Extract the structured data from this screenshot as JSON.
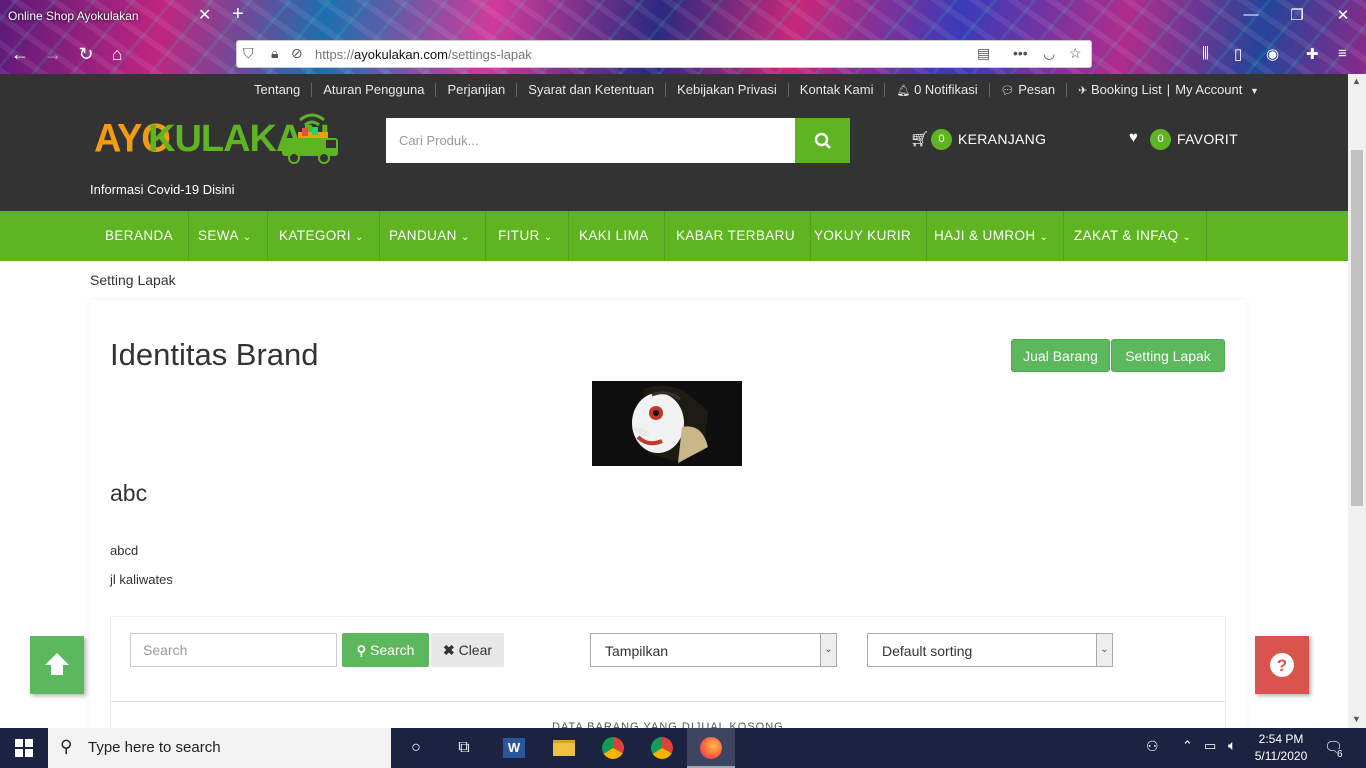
{
  "browser": {
    "tab_title": "Online Shop Ayokulakan",
    "url_prefix": "https://",
    "url_host": "ayokulakan.com",
    "url_path": "/settings-lapak"
  },
  "topbar": {
    "links": [
      "Tentang",
      "Aturan Pengguna",
      "Perjanjian",
      "Syarat dan Ketentuan",
      "Kebijakan Privasi",
      "Kontak Kami"
    ],
    "notifications": "0 Notifikasi",
    "messages": "Pesan",
    "booking": "Booking List",
    "account": "My Account"
  },
  "header": {
    "logo_word1": "AYO",
    "logo_word2": "KULAKAN",
    "covid_link": "Informasi Covid-19 Disini",
    "search_placeholder": "Cari Produk...",
    "cart_count": "0",
    "cart_label": "KERANJANG",
    "fav_count": "0",
    "fav_label": "FAVORIT"
  },
  "menu": [
    {
      "label": "BERANDA",
      "dropdown": false
    },
    {
      "label": "SEWA",
      "dropdown": true
    },
    {
      "label": "KATEGORI",
      "dropdown": true
    },
    {
      "label": "PANDUAN",
      "dropdown": true
    },
    {
      "label": "FITUR",
      "dropdown": true
    },
    {
      "label": "KAKI LIMA",
      "dropdown": false
    },
    {
      "label": "KABAR TERBARU",
      "dropdown": false
    },
    {
      "label": "YOKUY KURIR",
      "dropdown": false
    },
    {
      "label": "HAJI & UMROH",
      "dropdown": true
    },
    {
      "label": "ZAKAT & INFAQ",
      "dropdown": true
    }
  ],
  "page": {
    "breadcrumb": "Setting Lapak",
    "title": "Identitas Brand",
    "btn_sell": "Jual Barang",
    "btn_settings": "Setting Lapak",
    "shop_name": "abc",
    "description": "abcd",
    "address": "jl kaliwates"
  },
  "filters": {
    "search_placeholder": "Search",
    "search_btn": "Search",
    "clear_btn": "Clear",
    "display_select": "Tampilkan",
    "sort_select": "Default sorting",
    "next_section": "DATA BARANG YANG DIJUAL KOSONG"
  },
  "taskbar": {
    "search_placeholder": "Type here to search",
    "time": "2:54 PM",
    "date": "5/11/2020",
    "notif_count": "6"
  },
  "colors": {
    "brand_green": "#5fb521",
    "topbar_dark": "#333333",
    "help_red": "#d9534f",
    "logo_orange": "#f39c12"
  }
}
